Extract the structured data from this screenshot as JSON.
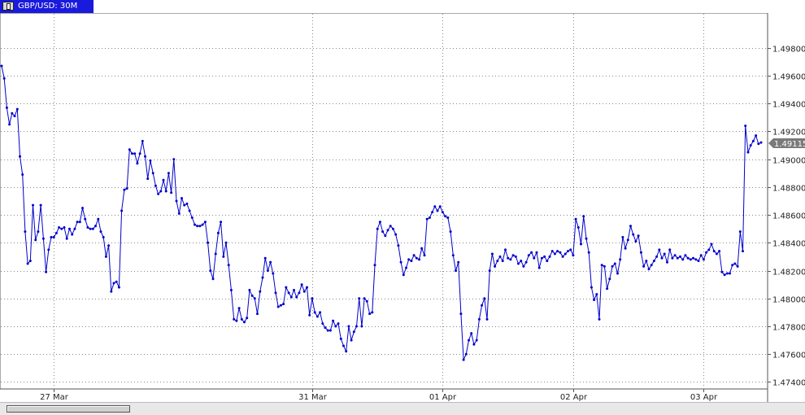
{
  "window": {
    "title": "GBP/USD: 30M",
    "icon": "window-icon"
  },
  "chart_data": {
    "type": "line",
    "title": "GBP/USD: 30M",
    "xlabel": "",
    "ylabel": "",
    "x_tick_labels": [
      "27 Mar",
      "31 Mar",
      "01 Apr",
      "02 Apr",
      "03 Apr"
    ],
    "y_ticks": [
      "1.47400",
      "1.47600",
      "1.47800",
      "1.48000",
      "1.48200",
      "1.48400",
      "1.48600",
      "1.48800",
      "1.49000",
      "1.49200",
      "1.49400",
      "1.49600",
      "1.49800"
    ],
    "ylim": [
      1.4735,
      1.5005
    ],
    "grid": true,
    "last_price_label": "1.49115",
    "series": [
      {
        "color": "#0000cc",
        "values": [
          1.4967,
          1.4958,
          1.4937,
          1.4925,
          1.4933,
          1.4931,
          1.4936,
          1.4902,
          1.4889,
          1.4848,
          1.4825,
          1.4827,
          1.4867,
          1.4842,
          1.4848,
          1.4867,
          1.4843,
          1.4819,
          1.4835,
          1.4844,
          1.4844,
          1.4847,
          1.4851,
          1.485,
          1.4851,
          1.4843,
          1.485,
          1.4846,
          1.485,
          1.4855,
          1.4855,
          1.4865,
          1.4857,
          1.4851,
          1.485,
          1.485,
          1.4852,
          1.4857,
          1.4848,
          1.4844,
          1.483,
          1.4838,
          1.4805,
          1.4811,
          1.4812,
          1.4808,
          1.4863,
          1.4878,
          1.4879,
          1.4907,
          1.4904,
          1.4904,
          1.4897,
          1.4904,
          1.4913,
          1.4902,
          1.4886,
          1.4899,
          1.489,
          1.4881,
          1.4875,
          1.4877,
          1.4885,
          1.4877,
          1.489,
          1.4876,
          1.49,
          1.487,
          1.4861,
          1.4872,
          1.4867,
          1.4868,
          1.4863,
          1.4858,
          1.4853,
          1.4852,
          1.4852,
          1.4853,
          1.4855,
          1.484,
          1.482,
          1.4814,
          1.4832,
          1.4847,
          1.4855,
          1.483,
          1.484,
          1.4824,
          1.4806,
          1.4785,
          1.4784,
          1.4793,
          1.4785,
          1.4783,
          1.4786,
          1.4806,
          1.4802,
          1.48,
          1.4789,
          1.4805,
          1.4815,
          1.4829,
          1.482,
          1.4826,
          1.4818,
          1.4804,
          1.4794,
          1.4795,
          1.4796,
          1.4808,
          1.4804,
          1.4801,
          1.4806,
          1.4801,
          1.4804,
          1.481,
          1.4805,
          1.4808,
          1.4788,
          1.48,
          1.479,
          1.4787,
          1.479,
          1.4782,
          1.4779,
          1.4777,
          1.4777,
          1.4784,
          1.478,
          1.4782,
          1.4771,
          1.4766,
          1.4762,
          1.478,
          1.477,
          1.4776,
          1.478,
          1.48,
          1.478,
          1.48,
          1.4798,
          1.4789,
          1.479,
          1.4824,
          1.485,
          1.4855,
          1.4848,
          1.4845,
          1.4849,
          1.4852,
          1.485,
          1.4846,
          1.4838,
          1.4826,
          1.4817,
          1.4822,
          1.4828,
          1.4827,
          1.4831,
          1.4829,
          1.4828,
          1.4836,
          1.4831,
          1.4857,
          1.4858,
          1.4862,
          1.4866,
          1.4863,
          1.4866,
          1.4862,
          1.4859,
          1.4858,
          1.4848,
          1.4831,
          1.482,
          1.4826,
          1.4789,
          1.4756,
          1.476,
          1.477,
          1.4775,
          1.4767,
          1.477,
          1.4785,
          1.4795,
          1.48,
          1.4785,
          1.482,
          1.4832,
          1.4823,
          1.4827,
          1.483,
          1.4827,
          1.4835,
          1.4829,
          1.4828,
          1.4831,
          1.483,
          1.4825,
          1.4827,
          1.4823,
          1.4826,
          1.4831,
          1.4833,
          1.4829,
          1.4833,
          1.4822,
          1.4829,
          1.483,
          1.4827,
          1.483,
          1.4834,
          1.4832,
          1.4834,
          1.4833,
          1.483,
          1.4832,
          1.4834,
          1.4835,
          1.4831,
          1.4857,
          1.4851,
          1.4839,
          1.4859,
          1.4843,
          1.4833,
          1.4808,
          1.4799,
          1.4803,
          1.4785,
          1.4824,
          1.4823,
          1.4807,
          1.4814,
          1.4823,
          1.4825,
          1.4818,
          1.4828,
          1.4844,
          1.4836,
          1.4842,
          1.4852,
          1.4846,
          1.4841,
          1.4845,
          1.4833,
          1.4823,
          1.4827,
          1.4821,
          1.4824,
          1.4827,
          1.483,
          1.4835,
          1.4829,
          1.4832,
          1.4826,
          1.4835,
          1.4829,
          1.4831,
          1.4829,
          1.483,
          1.4828,
          1.4831,
          1.4829,
          1.4828,
          1.4829,
          1.4828,
          1.4827,
          1.4831,
          1.4828,
          1.4833,
          1.4835,
          1.4839,
          1.4834,
          1.4832,
          1.4834,
          1.4819,
          1.4817,
          1.4818,
          1.4818,
          1.4824,
          1.4825,
          1.4823,
          1.4848,
          1.4834,
          1.4924,
          1.4905,
          1.491,
          1.4913,
          1.4917,
          1.4911,
          1.4912
        ]
      }
    ]
  }
}
